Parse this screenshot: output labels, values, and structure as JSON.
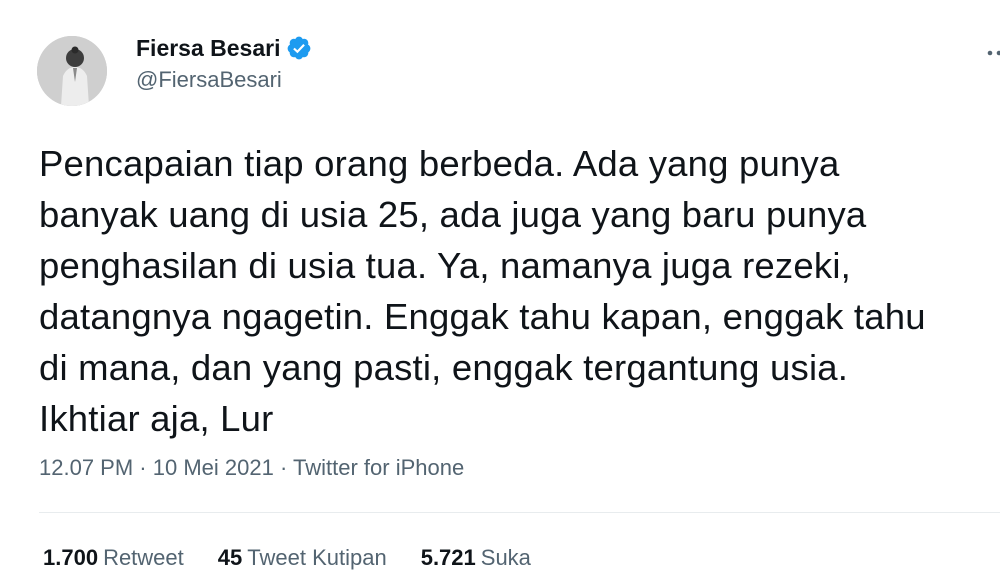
{
  "author": {
    "display_name": "Fiersa Besari",
    "handle": "@FiersaBesari",
    "verified_icon": "verified-badge-icon",
    "verified_color": "#1d9bf0"
  },
  "tweet": {
    "text": "Pencapaian tiap orang berbeda. Ada yang punya\nbanyak uang di usia 25, ada juga yang baru punya\npenghasilan di usia tua. Ya, namanya juga rezeki,\ndatangnya ngagetin. Enggak tahu kapan, enggak tahu\ndi mana, dan yang pasti, enggak tergantung usia.\nIkhtiar aja, Lur",
    "time": "12.07 PM",
    "separator": "·",
    "date": "10 Mei 2021",
    "source": "Twitter for iPhone"
  },
  "stats": {
    "retweets_count": "1.700",
    "retweets_label": "Retweet",
    "quotes_count": "45",
    "quotes_label": "Tweet Kutipan",
    "likes_count": "5.721",
    "likes_label": "Suka"
  },
  "menu": {
    "icon": "more-options-icon"
  },
  "colors": {
    "text_primary": "#0f1419",
    "text_secondary": "#536471",
    "divider": "#e8ecee"
  }
}
